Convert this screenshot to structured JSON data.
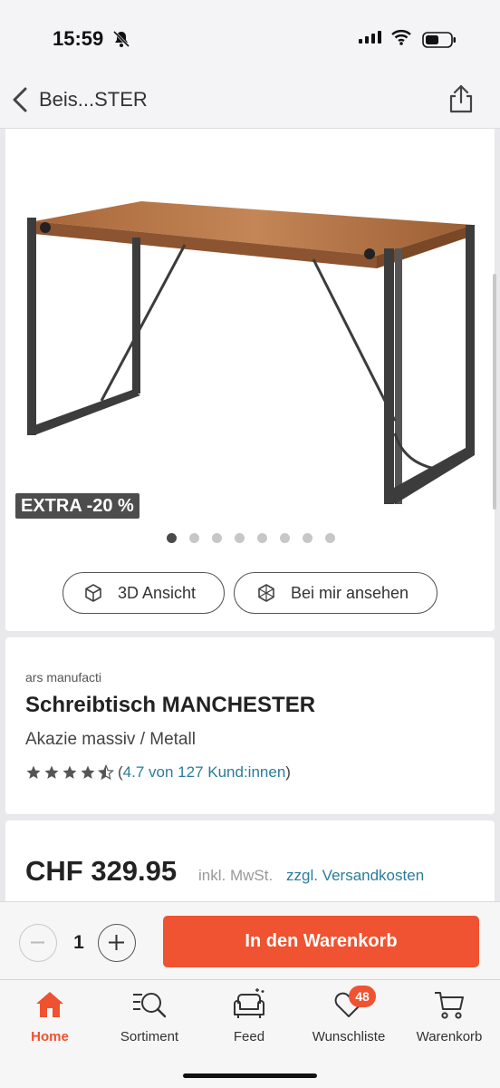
{
  "status_bar": {
    "time": "15:59"
  },
  "nav": {
    "title": "Beis...STER"
  },
  "gallery": {
    "badge": "EXTRA -20 %",
    "dot_count": 8,
    "active_dot": 1,
    "button_3d": "3D Ansicht",
    "button_ar": "Bei mir ansehen"
  },
  "product": {
    "brand": "ars manufacti",
    "title": "Schreibtisch MANCHESTER",
    "subtitle": "Akazie massiv / Metall",
    "rating": 4.7,
    "rating_text": "4.7 von 127 Kund:innen",
    "rating_open": "(",
    "rating_close": ")"
  },
  "price": {
    "amount": "CHF 329.95",
    "vat": "inkl. MwSt.",
    "shipping": "zzgl. Versandkosten"
  },
  "cart": {
    "quantity": "1",
    "button_label": "In den Warenkorb"
  },
  "tabs": [
    {
      "label": "Home",
      "icon": "home-icon",
      "active": true
    },
    {
      "label": "Sortiment",
      "icon": "search-list-icon",
      "active": false
    },
    {
      "label": "Feed",
      "icon": "sofa-icon",
      "active": false
    },
    {
      "label": "Wunschliste",
      "icon": "heart-icon",
      "active": false,
      "badge": "48"
    },
    {
      "label": "Warenkorb",
      "icon": "cart-icon",
      "active": false
    }
  ],
  "colors": {
    "accent": "#ef5331",
    "link": "#2b7c9a",
    "badge_bg": "#4d4d4d"
  }
}
